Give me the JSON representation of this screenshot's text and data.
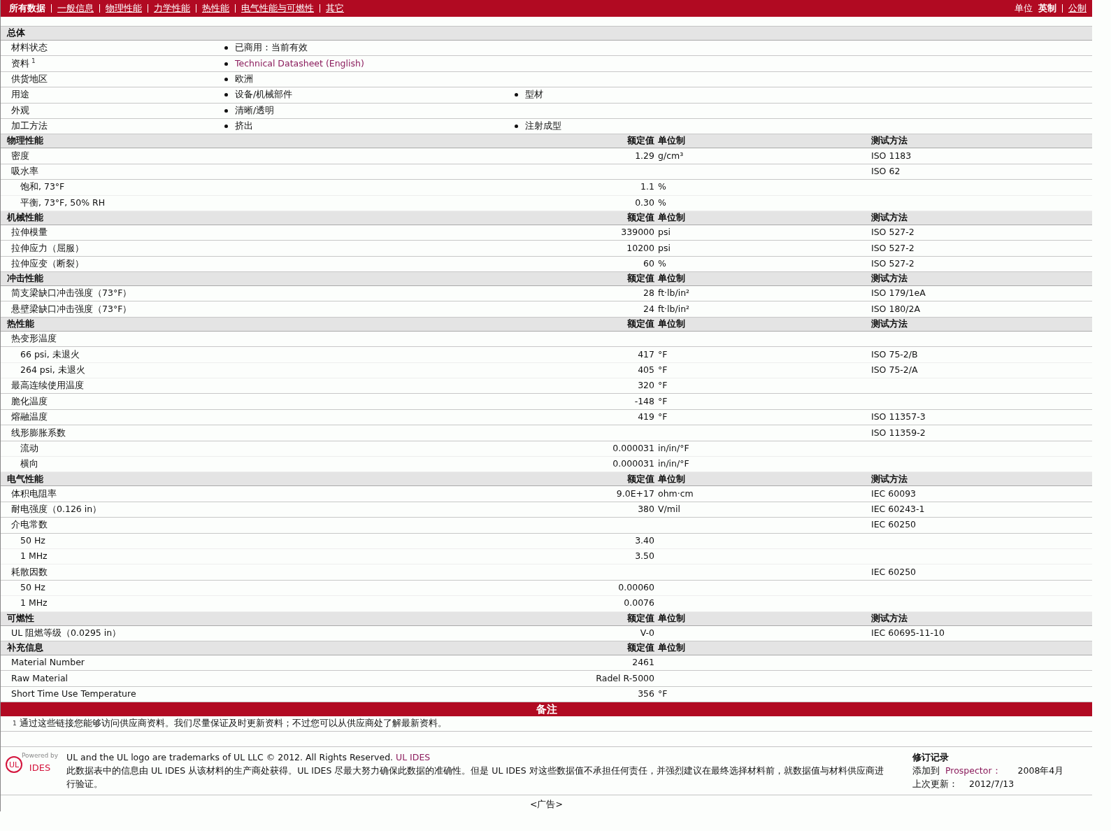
{
  "nav": {
    "tabs": [
      {
        "label": "所有数据",
        "selected": true
      },
      {
        "label": "一般信息",
        "selected": false
      },
      {
        "label": "物理性能",
        "selected": false
      },
      {
        "label": "力学性能",
        "selected": false
      },
      {
        "label": "热性能",
        "selected": false
      },
      {
        "label": "电气性能与可燃性",
        "selected": false
      },
      {
        "label": "其它",
        "selected": false
      }
    ],
    "units_label": "单位",
    "units": [
      {
        "label": "英制",
        "selected": true
      },
      {
        "label": "公制",
        "selected": false
      }
    ]
  },
  "general": {
    "title": "总体",
    "rows": [
      {
        "label": "材料状态",
        "items": [
          {
            "kind": "text",
            "text": "已商用：当前有效"
          }
        ]
      },
      {
        "label": "资料",
        "note": "1",
        "items": [
          {
            "kind": "link",
            "text": "Technical Datasheet (English)"
          }
        ]
      },
      {
        "label": "供货地区",
        "items": [
          {
            "kind": "text",
            "text": "欧洲"
          }
        ]
      },
      {
        "label": "用途",
        "items": [
          {
            "kind": "text",
            "text": "设备/机械部件"
          },
          {
            "kind": "text",
            "text": "型材"
          }
        ]
      },
      {
        "label": "外观",
        "items": [
          {
            "kind": "text",
            "text": "清晰/透明"
          }
        ]
      },
      {
        "label": "加工方法",
        "items": [
          {
            "kind": "text",
            "text": "挤出"
          },
          {
            "kind": "text",
            "text": "注射成型"
          }
        ]
      }
    ]
  },
  "sections": [
    {
      "title": "物理性能",
      "columns": [
        "额定值",
        "单位制",
        "测试方法"
      ],
      "rows": [
        {
          "name": "密度",
          "value": "1.29",
          "unit": "g/cm³",
          "method": "ISO 1183"
        },
        {
          "name": "吸水率",
          "method": "ISO 62",
          "children": [
            {
              "name": "饱和, 73°F",
              "value": "1.1",
              "unit": "%"
            },
            {
              "name": "平衡, 73°F, 50% RH",
              "value": "0.30",
              "unit": "%"
            }
          ]
        }
      ]
    },
    {
      "title": "机械性能",
      "columns": [
        "额定值",
        "单位制",
        "测试方法"
      ],
      "rows": [
        {
          "name": "拉伸模量",
          "value": "339000",
          "unit": "psi",
          "method": "ISO 527-2"
        },
        {
          "name": "拉伸应力（屈服）",
          "value": "10200",
          "unit": "psi",
          "method": "ISO 527-2"
        },
        {
          "name": "拉伸应变（断裂）",
          "value": "60",
          "unit": "%",
          "method": "ISO 527-2"
        }
      ]
    },
    {
      "title": "冲击性能",
      "columns": [
        "额定值",
        "单位制",
        "测试方法"
      ],
      "rows": [
        {
          "name": "简支梁缺口冲击强度（73°F）",
          "value": "28",
          "unit": "ft·lb/in²",
          "method": "ISO 179/1eA"
        },
        {
          "name": "悬壁梁缺口冲击强度（73°F）",
          "value": "24",
          "unit": "ft·lb/in²",
          "method": "ISO 180/2A"
        }
      ]
    },
    {
      "title": "热性能",
      "columns": [
        "额定值",
        "单位制",
        "测试方法"
      ],
      "rows": [
        {
          "name": "热变形温度",
          "children": [
            {
              "name": "66 psi, 未退火",
              "value": "417",
              "unit": "°F",
              "method": "ISO 75-2/B"
            },
            {
              "name": "264 psi, 未退火",
              "value": "405",
              "unit": "°F",
              "method": "ISO 75-2/A"
            }
          ]
        },
        {
          "name": "最高连续使用温度",
          "value": "320",
          "unit": "°F"
        },
        {
          "name": "脆化温度",
          "value": "-148",
          "unit": "°F"
        },
        {
          "name": "熔融温度",
          "value": "419",
          "unit": "°F",
          "method": "ISO 11357-3"
        },
        {
          "name": "线形膨胀系数",
          "method": "ISO 11359-2",
          "children": [
            {
              "name": "流动",
              "value": "0.000031",
              "unit": "in/in/°F"
            },
            {
              "name": "横向",
              "value": "0.000031",
              "unit": "in/in/°F"
            }
          ]
        }
      ]
    },
    {
      "title": "电气性能",
      "columns": [
        "额定值",
        "单位制",
        "测试方法"
      ],
      "rows": [
        {
          "name": "体积电阻率",
          "value": "9.0E+17",
          "unit": "ohm·cm",
          "method": "IEC 60093"
        },
        {
          "name": "耐电强度（0.126 in）",
          "value": "380",
          "unit": "V/mil",
          "method": "IEC 60243-1"
        },
        {
          "name": "介电常数",
          "method": "IEC 60250",
          "children": [
            {
              "name": "50 Hz",
              "value": "3.40"
            },
            {
              "name": "1 MHz",
              "value": "3.50"
            }
          ]
        },
        {
          "name": "耗散因数",
          "method": "IEC 60250",
          "children": [
            {
              "name": "50 Hz",
              "value": "0.00060"
            },
            {
              "name": "1 MHz",
              "value": "0.0076"
            }
          ]
        }
      ]
    },
    {
      "title": "可燃性",
      "columns": [
        "额定值",
        "单位制",
        "测试方法"
      ],
      "rows": [
        {
          "name": "UL 阻燃等级（0.0295 in）",
          "value": "V-0",
          "method": "IEC 60695-11-10"
        }
      ]
    },
    {
      "title": "补充信息",
      "columns": [
        "额定值",
        "单位制"
      ],
      "rows": [
        {
          "name": "Material Number",
          "value": "2461"
        },
        {
          "name": "Raw Material",
          "value": "Radel R-5000"
        },
        {
          "name": "Short Time Use Temperature",
          "value": "356",
          "unit": "°F"
        }
      ]
    }
  ],
  "notes": {
    "title": "备注",
    "items": [
      {
        "mark": "1",
        "text": "通过这些链接您能够访问供应商资料。我们尽量保证及时更新资料；不过您可以从供应商处了解最新资料。"
      }
    ]
  },
  "footer": {
    "logo": {
      "powered_by": "Powered by",
      "mark": "UL",
      "name": "IDES"
    },
    "trademark": "UL and the UL logo are trademarks of UL LLC © 2012. All Rights Reserved.",
    "trademark_link": "UL IDES",
    "disclaimer": "此数据表中的信息由 UL IDES 从该材料的生产商处获得。UL IDES 尽最大努力确保此数据的准确性。但是 UL IDES 对这些数据值不承担任何责任，并强烈建议在最终选择材料前，就数据值与材料供应商进行验证。",
    "revision": {
      "title": "修订记录",
      "added_label": "添加到",
      "added_link": "Prospector：",
      "added_date": "2008年4月",
      "updated_label": "上次更新：",
      "updated_date": "2012/7/13"
    }
  },
  "ad": "<广告>"
}
